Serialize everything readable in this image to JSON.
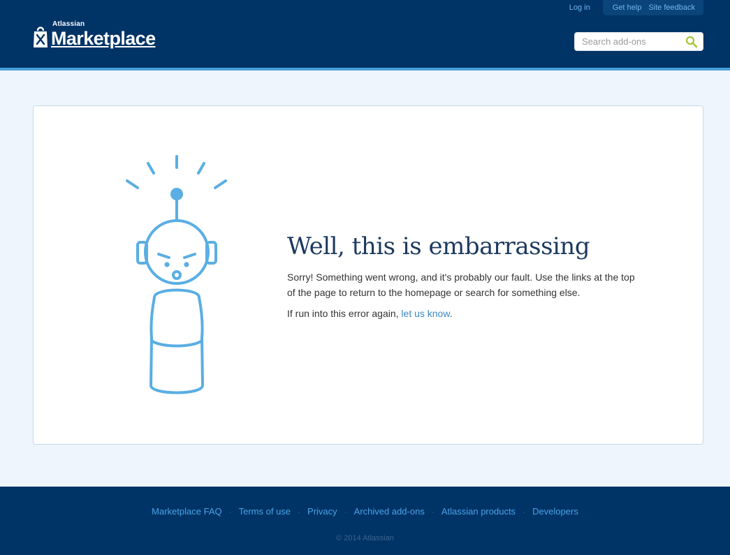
{
  "header": {
    "top_links": {
      "login": "Log in",
      "help": "Get help",
      "feedback": "Site feedback"
    },
    "logo": {
      "small": "Atlassian",
      "big": "Marketplace",
      "icon": "shopping-bag-icon"
    },
    "search": {
      "placeholder": "Search add-ons",
      "value": "",
      "icon": "search-icon"
    }
  },
  "main": {
    "illustration": "confused-robot-icon",
    "title": "Well, this is embarrassing",
    "paragraph": "Sorry! Something went wrong, and it's probably our fault. Use the links at the top of the page to return to the homepage or search for something else.",
    "error_prefix": "If run into this error again, ",
    "error_link": "let us know",
    "error_suffix": "."
  },
  "footer": {
    "links": [
      "Marketplace FAQ",
      "Terms of use",
      "Privacy",
      "Archived add-ons",
      "Atlassian products",
      "Developers"
    ],
    "separator": "·",
    "copyright": "© 2014 Atlassian"
  },
  "colors": {
    "header_bg": "#003366",
    "accent": "#4a9fd8",
    "link": "#3b88c3",
    "page_bg": "#eef5fc",
    "search_icon": "#a4c639"
  }
}
